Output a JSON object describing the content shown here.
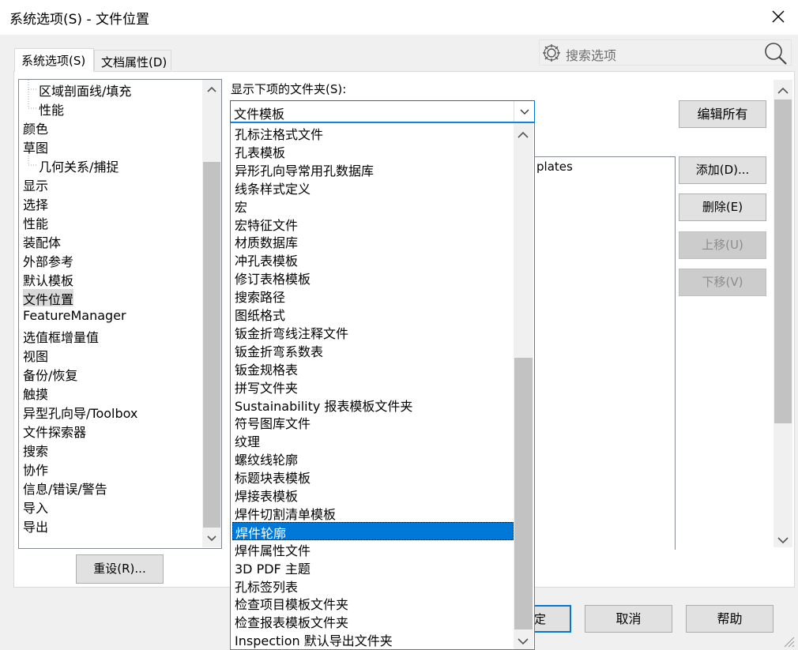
{
  "window": {
    "title": "系统选项(S) - 文件位置"
  },
  "search": {
    "placeholder": "搜索选项"
  },
  "tabs": [
    {
      "label": "系统选项(S)"
    },
    {
      "label": "文档属性(D)"
    }
  ],
  "tree": {
    "items": [
      {
        "label": "区域剖面线/填充",
        "child": true
      },
      {
        "label": "性能",
        "child": true
      },
      {
        "label": "颜色"
      },
      {
        "label": "草图"
      },
      {
        "label": "几何关系/捕捉",
        "child": true
      },
      {
        "label": "显示"
      },
      {
        "label": "选择"
      },
      {
        "label": "性能"
      },
      {
        "label": "装配体"
      },
      {
        "label": "外部参考"
      },
      {
        "label": "默认模板"
      },
      {
        "label": "文件位置",
        "selected": true
      },
      {
        "label": "FeatureManager"
      },
      {
        "label": "选值框增量值"
      },
      {
        "label": "视图"
      },
      {
        "label": "备份/恢复"
      },
      {
        "label": "触摸"
      },
      {
        "label": "异型孔向导/Toolbox"
      },
      {
        "label": "文件探索器"
      },
      {
        "label": "搜索"
      },
      {
        "label": "协作"
      },
      {
        "label": "信息/错误/警告"
      },
      {
        "label": "导入"
      },
      {
        "label": "导出"
      }
    ]
  },
  "buttons": {
    "reset": "重设(R)...",
    "edit_all": "编辑所有",
    "add": "添加(D)...",
    "delete": "删除(E)",
    "move_up": "上移(U)",
    "move_down": "下移(V)",
    "ok": "定",
    "cancel": "取消",
    "help": "帮助"
  },
  "combo": {
    "label": "显示下项的文件夹(S):",
    "value": "文件模板"
  },
  "folder_list": {
    "visible_text": "plates"
  },
  "dropdown": {
    "items": [
      "孔标注格式文件",
      "孔表模板",
      "异形孔向导常用孔数据库",
      "线条样式定义",
      "宏",
      "宏特征文件",
      "材质数据库",
      "冲孔表模板",
      "修订表格模板",
      "搜索路径",
      "图纸格式",
      "钣金折弯线注释文件",
      "钣金折弯系数表",
      "钣金规格表",
      "拼写文件夹",
      "Sustainability 报表模板文件夹",
      "符号图库文件",
      "纹理",
      "螺纹线轮廓",
      "标题块表模板",
      "焊接表模板",
      "焊件切割清单模板",
      "焊件轮廓",
      "焊件属性文件",
      "3D PDF 主题",
      "孔标签列表",
      "检查项目模板文件夹",
      "检查报表模板文件夹",
      "Inspection 默认导出文件夹"
    ],
    "highlighted": "焊件轮廓"
  },
  "icons": {
    "close": "close-icon",
    "gear": "gear-icon",
    "search": "search-icon",
    "chevron_down": "chevron-down-icon",
    "chevron_up": "chevron-up-icon"
  },
  "colors": {
    "accent": "#0078d7",
    "dialog_bg": "#f0f0f0",
    "scroll_thumb": "#c2c2c2"
  }
}
